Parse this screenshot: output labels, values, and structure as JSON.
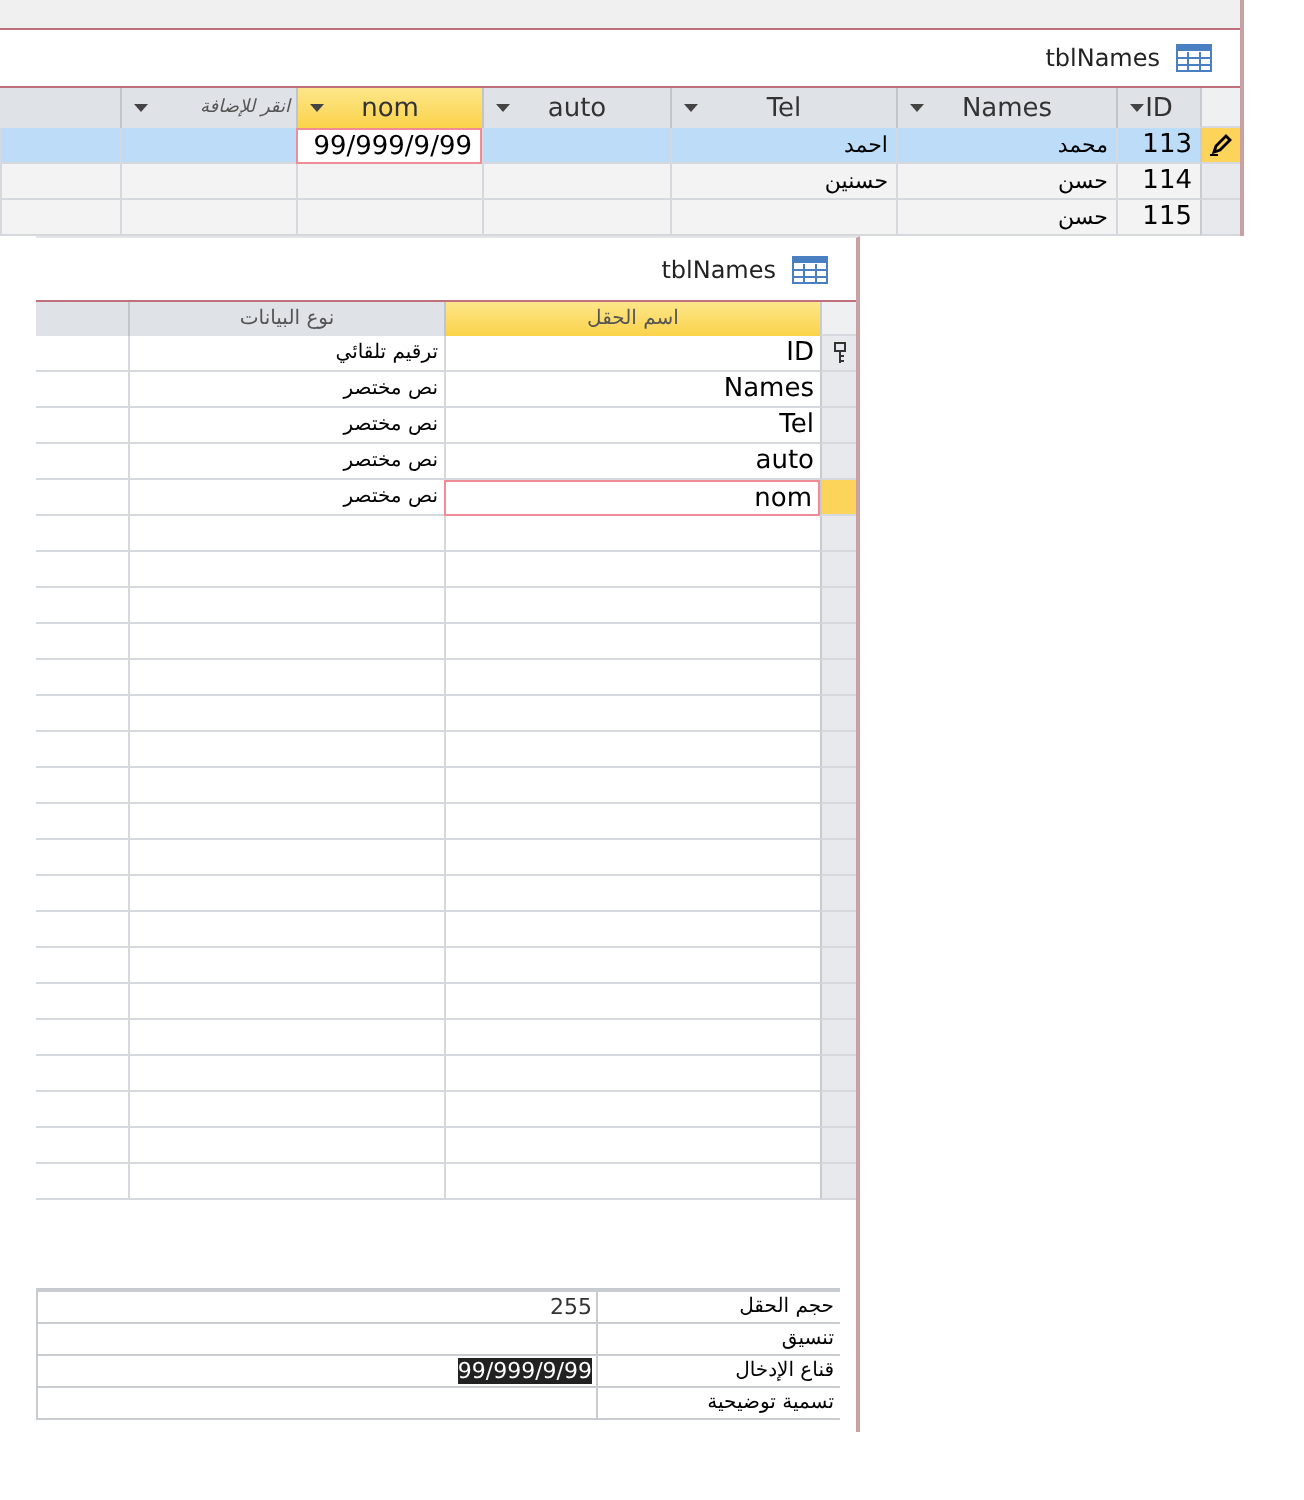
{
  "datasheet": {
    "title": "tblNames",
    "columns": [
      {
        "label": "ID",
        "kind": "field",
        "selected": false
      },
      {
        "label": "Names",
        "kind": "field",
        "selected": false
      },
      {
        "label": "Tel",
        "kind": "field",
        "selected": false
      },
      {
        "label": "auto",
        "kind": "field",
        "selected": false
      },
      {
        "label": "nom",
        "kind": "field",
        "selected": true
      },
      {
        "label": "انقر للإضافة",
        "kind": "add",
        "selected": false
      }
    ],
    "rows": [
      {
        "selected": true,
        "editing": true,
        "cells": [
          "113",
          "محمد",
          "احمد",
          "",
          "99/999/9/99",
          ""
        ]
      },
      {
        "selected": false,
        "editing": false,
        "cells": [
          "114",
          "حسن",
          "حسنين",
          "",
          "",
          ""
        ]
      },
      {
        "selected": false,
        "editing": false,
        "cells": [
          "115",
          "حسن",
          "",
          "",
          "",
          ""
        ]
      }
    ]
  },
  "design": {
    "title": "tblNames",
    "columns": [
      {
        "label": "اسم الحقل",
        "selected": true
      },
      {
        "label": "نوع البيانات",
        "selected": false
      }
    ],
    "fields": [
      {
        "name": "ID",
        "type": "ترقيم تلقائي",
        "primary_key": true,
        "selected": false
      },
      {
        "name": "Names",
        "type": "نص مختصر",
        "primary_key": false,
        "selected": false
      },
      {
        "name": "Tel",
        "type": "نص مختصر",
        "primary_key": false,
        "selected": false
      },
      {
        "name": "auto",
        "type": "نص مختصر",
        "primary_key": false,
        "selected": false
      },
      {
        "name": "nom",
        "type": "نص مختصر",
        "primary_key": false,
        "selected": true
      }
    ],
    "properties": [
      {
        "label": "حجم الحقل",
        "value": "255"
      },
      {
        "label": "تنسيق"
      },
      {
        "label": "قناع الإدخال",
        "value": "99/999/9/99",
        "highlighted": true
      },
      {
        "label": "تسمية توضيحية"
      }
    ]
  }
}
